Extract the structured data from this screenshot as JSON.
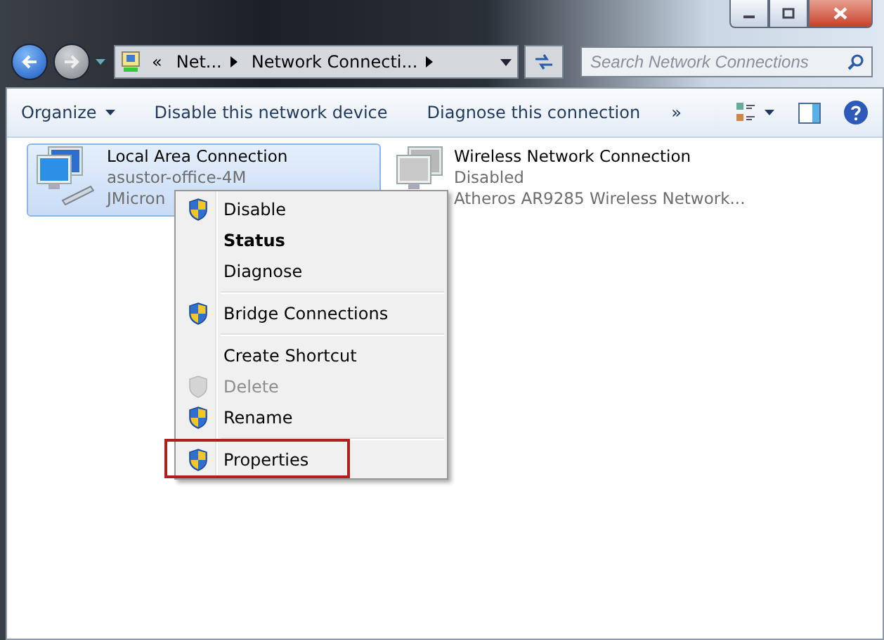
{
  "address": {
    "overflow": "«",
    "crumbs": [
      "Net...",
      "Network Connecti..."
    ]
  },
  "search": {
    "placeholder": "Search Network Connections"
  },
  "toolbar": {
    "items": [
      {
        "label": "Organize",
        "dropdown": true
      },
      {
        "label": "Disable this network device",
        "dropdown": false
      },
      {
        "label": "Diagnose this connection",
        "dropdown": false
      }
    ],
    "more": "»"
  },
  "connections": [
    {
      "name": "Local Area Connection",
      "status": "asustor-office-4M",
      "device": "JMicron",
      "selected": true,
      "disabled": false
    },
    {
      "name": "Wireless Network Connection",
      "status": "Disabled",
      "device": "Atheros AR9285 Wireless Network...",
      "selected": false,
      "disabled": true
    }
  ],
  "context_menu": [
    {
      "kind": "item",
      "label": "Disable",
      "shield": true,
      "bold": false,
      "disabled": false,
      "highlighted": false
    },
    {
      "kind": "item",
      "label": "Status",
      "shield": false,
      "bold": true,
      "disabled": false,
      "highlighted": false
    },
    {
      "kind": "item",
      "label": "Diagnose",
      "shield": false,
      "bold": false,
      "disabled": false,
      "highlighted": false
    },
    {
      "kind": "separator"
    },
    {
      "kind": "item",
      "label": "Bridge Connections",
      "shield": true,
      "bold": false,
      "disabled": false,
      "highlighted": false
    },
    {
      "kind": "separator"
    },
    {
      "kind": "item",
      "label": "Create Shortcut",
      "shield": false,
      "bold": false,
      "disabled": false,
      "highlighted": false
    },
    {
      "kind": "item",
      "label": "Delete",
      "shield": true,
      "bold": false,
      "disabled": true,
      "highlighted": false
    },
    {
      "kind": "item",
      "label": "Rename",
      "shield": true,
      "bold": false,
      "disabled": false,
      "highlighted": false
    },
    {
      "kind": "separator"
    },
    {
      "kind": "item",
      "label": "Properties",
      "shield": true,
      "bold": false,
      "disabled": false,
      "highlighted": true
    }
  ]
}
